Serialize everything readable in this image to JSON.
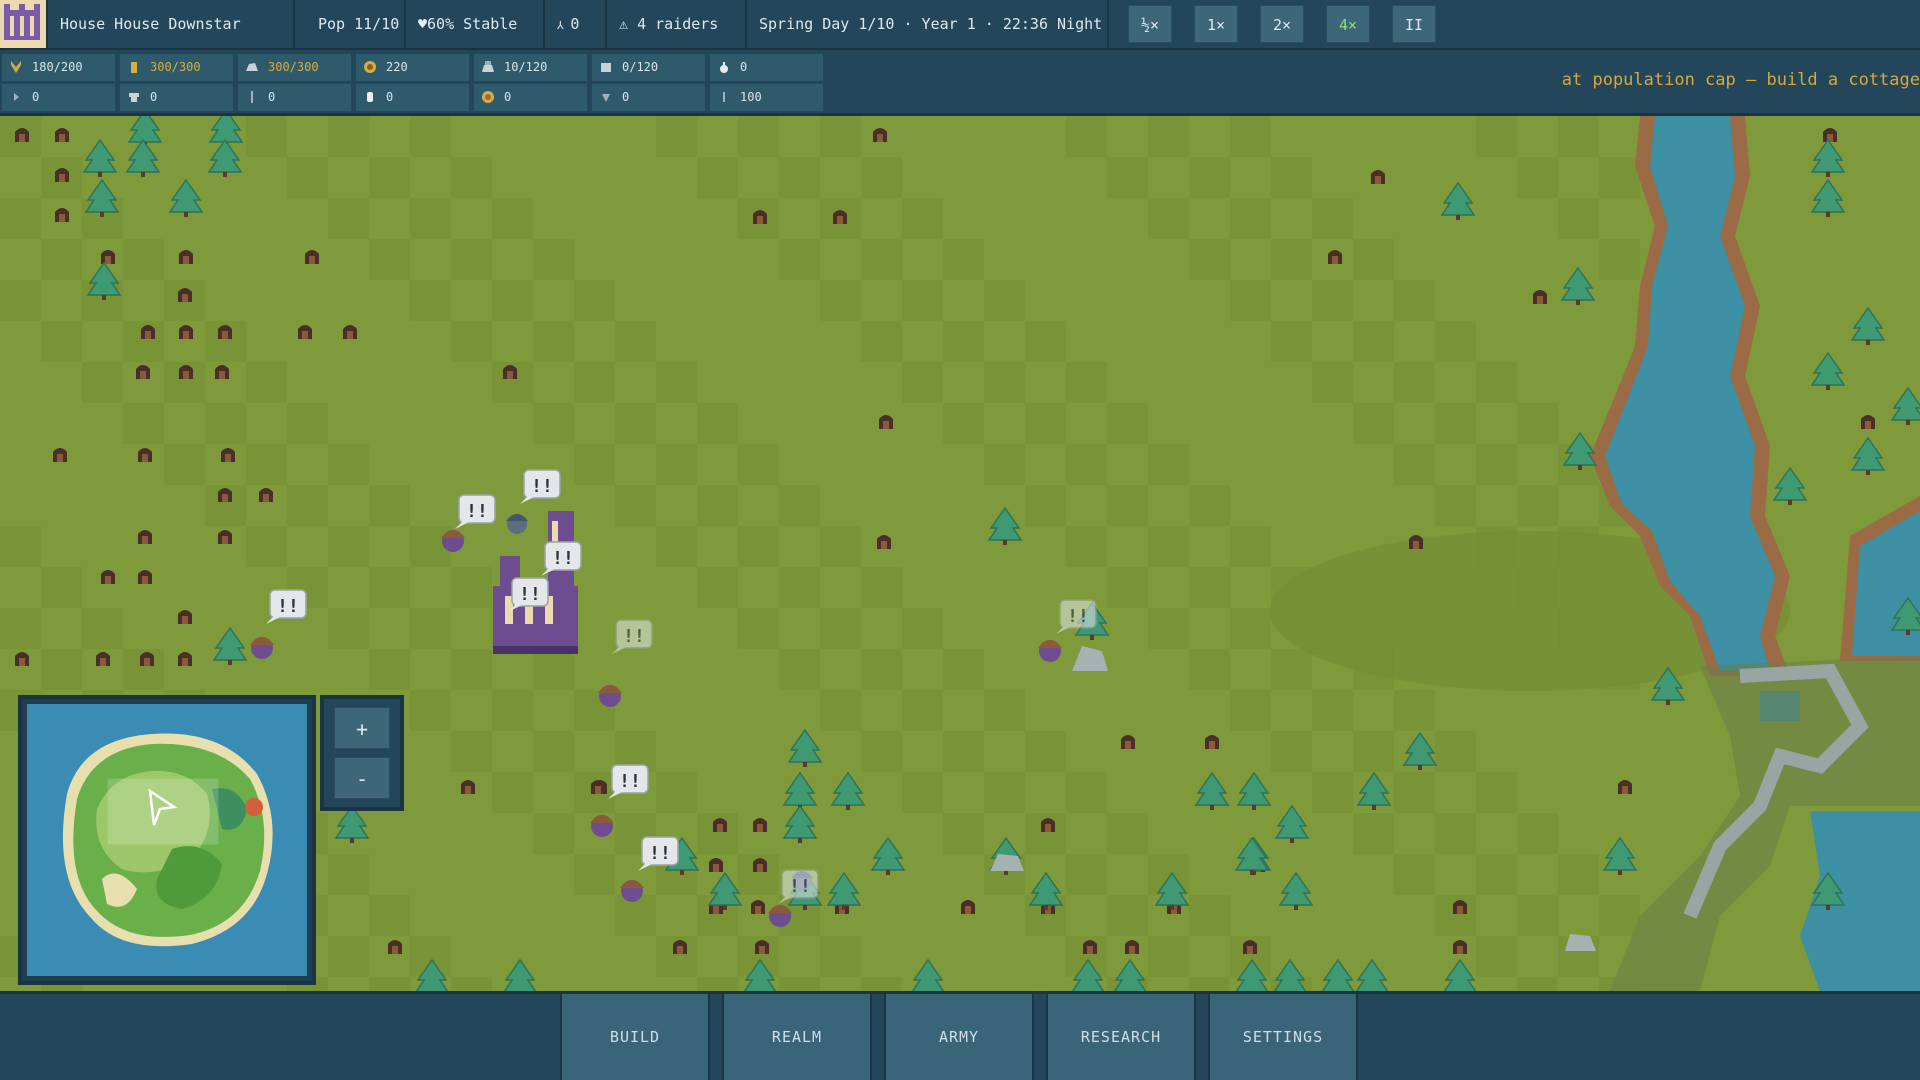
{
  "topbar": {
    "house": "House House Downstar",
    "population": "Pop 11/10",
    "stability": "60% Stable",
    "soldiers": "0",
    "raiders": "4 raiders",
    "date": "Spring Day 1/10 · Year 1 · 22:36 Night",
    "speeds": [
      "½×",
      "1×",
      "2×",
      "4×"
    ],
    "active_speed": "4×",
    "pause_label": "II"
  },
  "resources": {
    "row1": [
      {
        "icon": "wheat-icon",
        "label": "180/200"
      },
      {
        "icon": "wood-icon",
        "label": "300/300",
        "gold": true
      },
      {
        "icon": "stone-icon",
        "label": "300/300",
        "gold": true
      },
      {
        "icon": "coin-icon",
        "label": "220"
      },
      {
        "icon": "iron-icon",
        "label": "10/120"
      },
      {
        "icon": "cloth-icon",
        "label": "0/120"
      },
      {
        "icon": "potion-icon",
        "label": "0"
      }
    ],
    "row2": [
      {
        "icon": "arrow-icon",
        "label": "0"
      },
      {
        "icon": "anvil-icon",
        "label": "0"
      },
      {
        "icon": "sword-icon",
        "label": "0"
      },
      {
        "icon": "lantern-icon",
        "label": "0"
      },
      {
        "icon": "shield-icon",
        "label": "0"
      },
      {
        "icon": "horse-icon",
        "label": "0"
      },
      {
        "icon": "scroll-icon",
        "label": "100"
      }
    ]
  },
  "notice": "at population cap — build a cottage",
  "map": {
    "alert_label": "!!",
    "colors": {
      "grass": "#7f9a3a",
      "grass_dark": "#789436",
      "river": "#3d8fa3",
      "bank": "#9a6b45",
      "tree": "#3f9a74",
      "stump": "#4a2f28"
    }
  },
  "zoom": {
    "in_label": "+",
    "out_label": "-"
  },
  "bottom_menu": [
    "BUILD",
    "REALM",
    "ARMY",
    "RESEARCH",
    "SETTINGS"
  ]
}
